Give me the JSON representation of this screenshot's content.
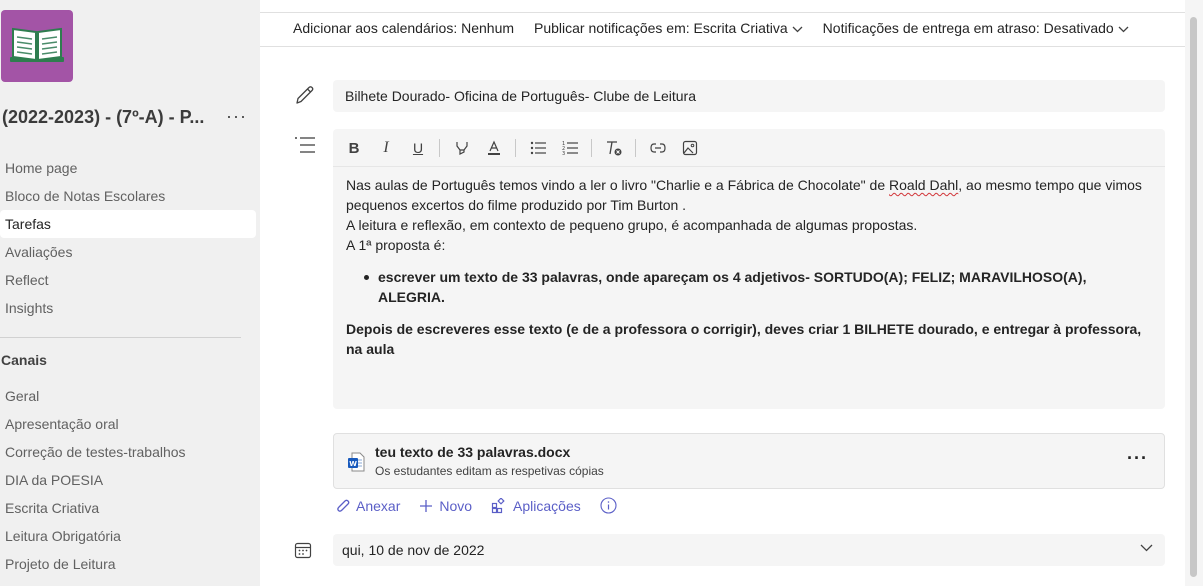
{
  "sidebar": {
    "team_name": "(2022-2023) - (7º-A) - P...",
    "more_label": "···",
    "nav_items": [
      {
        "label": "Home page"
      },
      {
        "label": "Bloco de Notas Escolares"
      },
      {
        "label": "Tarefas",
        "active": true
      },
      {
        "label": "Avaliações"
      },
      {
        "label": "Reflect"
      },
      {
        "label": "Insights"
      }
    ],
    "channels_title": "Canais",
    "channels": [
      {
        "label": "Geral"
      },
      {
        "label": "Apresentação oral"
      },
      {
        "label": "Correção de testes-trabalhos"
      },
      {
        "label": "DIA da POESIA"
      },
      {
        "label": "Escrita Criativa"
      },
      {
        "label": "Leitura Obrigatória"
      },
      {
        "label": "Projeto de Leitura"
      }
    ]
  },
  "toolbar": {
    "calendars": "Adicionar aos calendários: Nenhum",
    "publish": "Publicar notificações em: Escrita Criativa",
    "late": "Notificações de entrega em atraso: Desativado"
  },
  "assignment": {
    "title": "Bilhete Dourado- Oficina de Português- Clube de Leitura",
    "instructions": {
      "line1_before": "Nas aulas de Português temos vindo a ler o livro \"Charlie e a Fábrica de Chocolate\" de ",
      "line1_name": "Roald Dahl",
      "line1_after": ", ao mesmo tempo que vimos pequenos excertos do filme produzido por Tim Burton .",
      "line2": "A leitura e reflexão, em contexto de pequeno grupo, é acompanhada de algumas propostas.",
      "line3": "A 1ª proposta é:",
      "bullet": "escrever um texto de 33 palavras, onde apareçam os 4 adjetivos- SORTUDO(A); FELIZ; MARAVILHOSO(A), ALEGRIA.",
      "closing": "Depois de escreveres esse texto (e de a professora o corrigir), deves criar 1 BILHETE dourado, e entregar à professora, na aula"
    },
    "attachment": {
      "name": "teu texto de 33 palavras.docx",
      "subtitle": "Os estudantes editam as respetivas cópias",
      "more_label": "···"
    },
    "actions": {
      "attach": "Anexar",
      "new": "Novo",
      "apps": "Aplicações"
    },
    "due_date": "qui, 10 de nov de 2022"
  },
  "colors": {
    "accent": "#5b5fc7",
    "team_logo_bg": "#a354a6",
    "spell_error": "#d13438"
  }
}
